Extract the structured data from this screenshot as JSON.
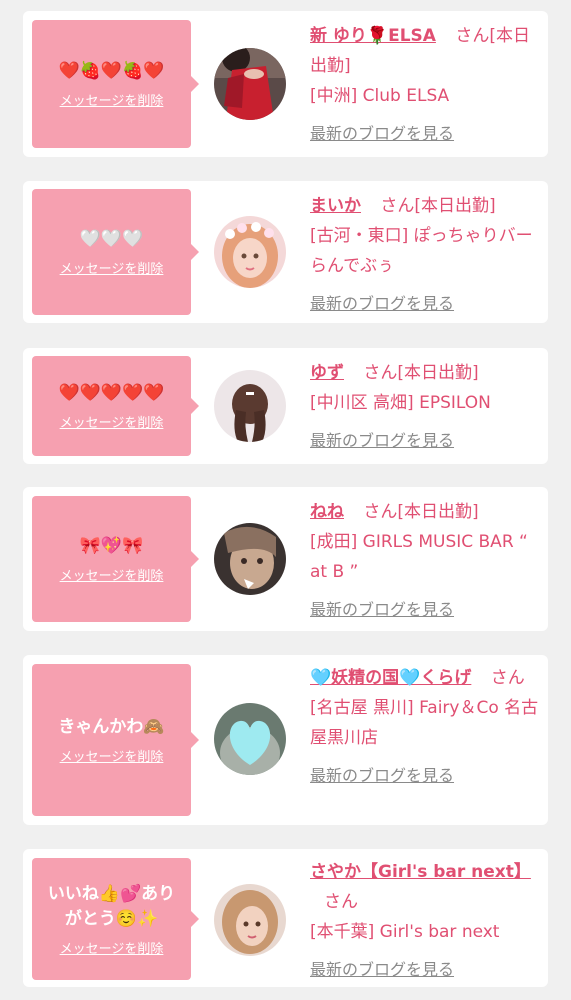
{
  "common": {
    "delete_label": "メッセージを削除",
    "blog_label": "最新のブログを見る",
    "san_suffix": "さん"
  },
  "messages": [
    {
      "message": "❤️🍓❤️🍓❤️",
      "name": "新 ゆり🌹ELSA",
      "status": "[本日出勤]",
      "location": "[中洲] Club ELSA",
      "avatar_icon": "avatar-woman-red-dress"
    },
    {
      "message": "🤍🤍🤍",
      "name": "まいか",
      "status": "[本日出勤]",
      "location": "[古河・東口] ぽっちゃりバー らんでぶぅ",
      "avatar_icon": "avatar-woman-flower-crown"
    },
    {
      "message": "❤️❤️❤️❤️❤️",
      "name": "ゆず",
      "status": "[本日出勤]",
      "location": "[中川区 高畑] EPSILON",
      "avatar_icon": "avatar-woman-braided-hair"
    },
    {
      "message": "🎀💖🎀",
      "name": "ねね",
      "status": "[本日出勤]",
      "location": "[成田] GIRLS MUSIC BAR “ at B ”",
      "avatar_icon": "avatar-woman-selfie"
    },
    {
      "message": "きゃんかわ🙈",
      "name": "🩵妖精の国🩵くらげ",
      "status": "",
      "location": "[名古屋 黒川] Fairy＆Co 名古屋黒川店",
      "avatar_icon": "avatar-heart-covered-face"
    },
    {
      "message": "いいね👍💕ありがとう☺️✨",
      "name": "さやか【Girl's bar next】",
      "status": "",
      "location": "[本千葉] Girl's bar next",
      "avatar_icon": "avatar-woman-blonde"
    }
  ],
  "colors": {
    "bubble": "#f6a0b0",
    "accent": "#e04f72",
    "blog_link": "#8a8a8a",
    "background": "#f0f0f0"
  }
}
